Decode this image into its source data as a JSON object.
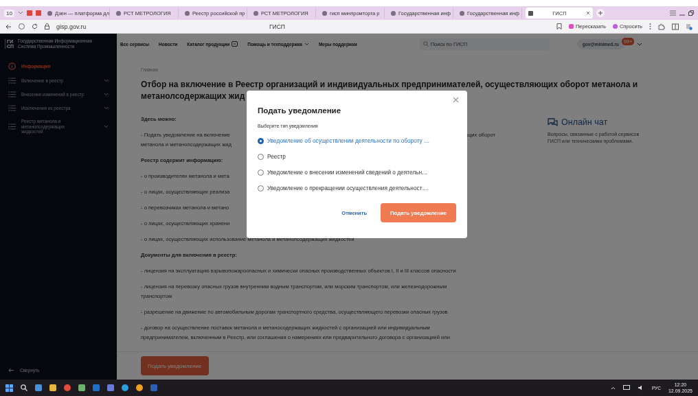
{
  "browser": {
    "tab_count": "10",
    "tabs": [
      {
        "label": "Дзен — платформа дл",
        "selected": false
      },
      {
        "label": "РСТ МЕТРОЛОГИЯ",
        "selected": false
      },
      {
        "label": "Реестр российской пр",
        "selected": false
      },
      {
        "label": "РСТ МЕТРОЛОГИЯ",
        "selected": false
      },
      {
        "label": "гисп минпромторга р",
        "selected": false
      },
      {
        "label": "Государственная инф",
        "selected": false
      },
      {
        "label": "Государственная инф",
        "selected": false
      },
      {
        "label": "ГИСП",
        "selected": true
      }
    ],
    "address": "gisp.gov.ru",
    "page_title": "ГИСП",
    "actions": [
      "Пересказать",
      "Спросить"
    ]
  },
  "site_header": {
    "logo_mark": [
      "ГИ",
      "СП"
    ],
    "logo_text": [
      "Государственная Информационная",
      "Система Промышленности"
    ],
    "nav": [
      {
        "label": "Все сервисы",
        "kind": "plain"
      },
      {
        "label": "Новости",
        "kind": "plain"
      },
      {
        "label": "Каталог продукции",
        "kind": "icon"
      },
      {
        "label": "Помощь и техподдержка",
        "kind": "dropdown"
      },
      {
        "label": "Меры поддержки",
        "kind": "plain"
      }
    ],
    "search": {
      "placeholder": "Поиск по ГИСП"
    },
    "user": "gov@minimed.ru",
    "badge": "99+"
  },
  "sidebar": {
    "items": [
      {
        "label": "Информация",
        "kind": "info",
        "selected": true,
        "expandable": false
      },
      {
        "label": "Включение в реестр",
        "kind": "list",
        "selected": false,
        "expandable": true
      },
      {
        "label": "Внесение изменений в реестр",
        "kind": "list",
        "selected": false,
        "expandable": true
      },
      {
        "label": "Исключения из реестра",
        "kind": "list",
        "selected": false,
        "expandable": true
      },
      {
        "label": "Реестр метанола и метанолсодержащих жидкостей",
        "kind": "list",
        "selected": false,
        "expandable": true
      }
    ],
    "collapse": "Свернуть"
  },
  "breadcrumb": "Главная",
  "title": [
    "Отбор на включение в Реестр организаций и индивидуальных предпринимателей, осуществляющих оборот метанола и",
    "метанолсодержащих жид"
  ],
  "content": [
    {
      "kind": "heading",
      "lines": [
        "Здесь можно:"
      ]
    },
    {
      "kind": "covered",
      "lines": [
        {
          "left": "- Подать уведомление на включение",
          "right": "щих оборот"
        },
        {
          "left": "метанола и метанолсодержащих жид"
        }
      ]
    },
    {
      "kind": "heading",
      "lines": [
        "Реестр содержит информацию:"
      ]
    },
    {
      "kind": "covered",
      "lines": [
        {
          "left": "- о производителях метанола и мета"
        }
      ]
    },
    {
      "kind": "covered",
      "lines": [
        {
          "left": "- о лицах, осуществляющих реализа"
        }
      ]
    },
    {
      "kind": "covered",
      "lines": [
        {
          "left": "- о перевозчиках метанола и метано"
        }
      ]
    },
    {
      "kind": "covered",
      "lines": [
        {
          "left": "- о лицах, осуществляющих хранени"
        }
      ]
    },
    {
      "kind": "text",
      "lines": [
        "- о лицах, осуществляющих использование метанола и метанолсодержащих жидкостей"
      ]
    },
    {
      "kind": "heading",
      "lines": [
        "Документы для включения в реестр:"
      ]
    },
    {
      "kind": "text",
      "lines": [
        "- лицензия на эксплуатацию взрывопожароопасных и химически опасных производственных объектов I, II и III классов опасности"
      ]
    },
    {
      "kind": "text",
      "lines": [
        "- лицензия на перевозку опасных грузов внутренним водным транспортом, или морским транспортом, или железнодорожным",
        "транспортом"
      ]
    },
    {
      "kind": "text",
      "lines": [
        "- разрешение на движение по автомобильным дорогам транспортного средства, осуществляющего перевозки опасных грузов"
      ]
    },
    {
      "kind": "text",
      "lines": [
        "- договор на осуществление поставок метанола и метаносодержащих жидкостей с организацией или индивидуальным",
        "предпринимателем, включенным в Реестр, или соглашения о намерениях или предварительного договора с организацией или"
      ]
    }
  ],
  "aside": {
    "title": "Онлайн чат",
    "text": "Вопросы, связанные с работой сервисов ГИСП или техническими проблемами."
  },
  "footer_button": "Подать уведомление",
  "modal": {
    "title": "Подать уведомление",
    "subtitle": "Выберите тип уведомления",
    "options": [
      {
        "label": "Уведомление об осуществлении деятельности по обороту …",
        "selected": true
      },
      {
        "label": "Реестр",
        "selected": false
      },
      {
        "label": "Уведомление о внесении изменений сведений о деятельн…",
        "selected": false
      },
      {
        "label": "Уведомление о прекращении осуществления деятельност…",
        "selected": false
      }
    ],
    "cancel": "Отменить",
    "submit": "Подать уведомление"
  },
  "taskbar": {
    "language": "РУС",
    "time": "12:20",
    "date": "12.09.2025"
  }
}
